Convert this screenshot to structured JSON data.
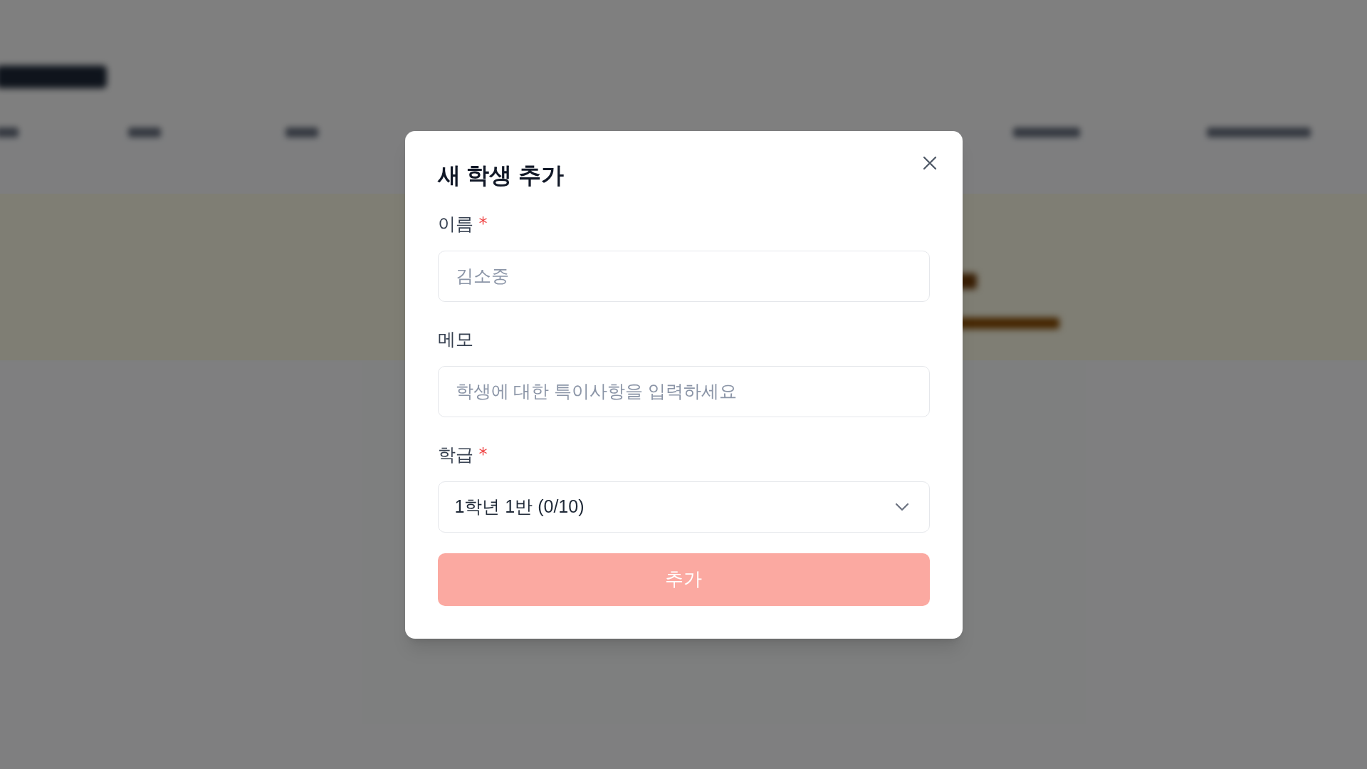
{
  "dialog": {
    "title": "새 학생 추가",
    "fields": [
      {
        "kind": "text",
        "label": "이름",
        "required_mark": "*",
        "placeholder": "김소중"
      },
      {
        "kind": "text",
        "label": "메모",
        "placeholder": "학생에 대한 특이사항을 입력하세요"
      },
      {
        "kind": "select",
        "label": "학급",
        "required_mark": "*",
        "value": "1학년 1반 (0/10)"
      }
    ],
    "submit": {
      "label": "추가",
      "disabled": true
    }
  }
}
